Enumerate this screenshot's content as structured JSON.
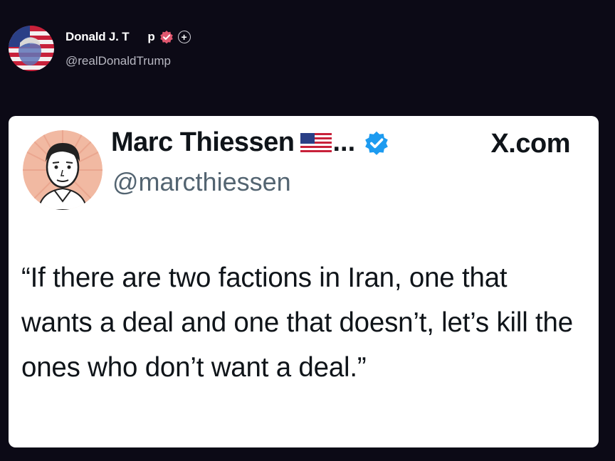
{
  "post": {
    "author_name": "Donald J. T",
    "author_name_tail": "p",
    "author_handle": "@realDonaldTrump",
    "follow_label": "+"
  },
  "quoted": {
    "name": "Marc Thiessen",
    "ellipsis": "...",
    "handle": "@marcthiessen",
    "source": "X.com",
    "text": "“If there are two factions in Iran, one that wants a deal and one that doesn’t, let’s kill the ones who don’t want a deal.”"
  },
  "icons": {
    "author_badge": "verified-badge-icon",
    "quoted_badge": "verified-badge-icon",
    "flag": "us-flag-icon"
  },
  "colors": {
    "background": "#0c0a16",
    "card": "#ffffff",
    "text": "#0f1419",
    "handle": "#536471",
    "verified_blue": "#1d9bf0",
    "author_badge_pink": "#e0576f"
  }
}
